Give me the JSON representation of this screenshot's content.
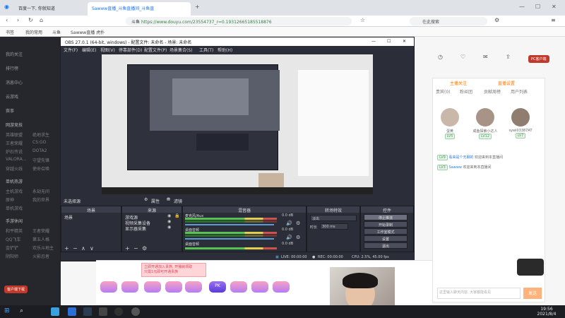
{
  "browser": {
    "tabs": [
      {
        "label": "百度一下, 你就知道",
        "active": false
      },
      {
        "label": "Sawww直播_斗鱼直播间_斗鱼直",
        "active": true
      }
    ],
    "url": "https://www.douyu.com/23554737_r=0.19312665185518876",
    "url_prefix": "斗鱼",
    "search_placeholder": "在此搜索",
    "bookmarks": [
      "书签",
      "我的常用",
      "斗鱼",
      "Sawww直播 虎扑"
    ]
  },
  "sidebar": {
    "items": [
      "我的关注",
      "排行榜",
      "消息中心",
      "云游戏",
      "赛事"
    ],
    "sections": [
      {
        "title": "网游竞技",
        "subs": [
          "英雄联盟",
          "绝地求生",
          "王者荣耀",
          "CS:GO",
          "炉石传说",
          "DOTA2",
          "VALORA...",
          "守望先锋",
          "穿越火线",
          "使命召唤"
        ]
      },
      {
        "title": "单机热游",
        "subs": [
          "主机游戏",
          "永劫无间",
          "原神",
          "我的世界",
          "单机游戏"
        ]
      },
      {
        "title": "手游休闲",
        "subs": [
          "和平精英",
          "王者荣耀",
          "QQ飞车",
          "第五人格",
          "金铲铲",
          "欢乐斗地主",
          "阴阳师",
          "火影忍者"
        ]
      }
    ],
    "buttons": [
      "客户端下载",
      "开播"
    ]
  },
  "obs": {
    "title": "OBS 27.0.1 (64-bit, windows) - 配置文件: 未命名 - 场景: 未命名",
    "menu": [
      "文件(F)",
      "编辑(E)",
      "视图(V)",
      "停靠部件(D)",
      "配置文件(P)",
      "场景集合(S)",
      "工具(T)",
      "帮助(H)"
    ],
    "window_controls": [
      "—",
      "☐",
      "✕"
    ],
    "source_selection": "未选择源",
    "toolbar": [
      "属性",
      "滤镜"
    ],
    "scenes": {
      "title": "场景",
      "items": [
        "场景"
      ]
    },
    "sources": {
      "title": "来源",
      "items": [
        "游戏源",
        "视频采集设备",
        "显示器采集"
      ]
    },
    "mixer": {
      "title": "混音器",
      "channels": [
        {
          "name": "麦克风/Aux",
          "db": "0.0 dB"
        },
        {
          "name": "桌面音频",
          "db": "0.0 dB"
        },
        {
          "name": "桌面音频",
          "db": "0.0 dB"
        }
      ]
    },
    "transitions": {
      "title": "转场特效",
      "type": "淡出",
      "duration_label": "时长",
      "duration": "300 ms"
    },
    "controls": {
      "title": "控件",
      "buttons": [
        "停止推流",
        "开始录制",
        "工作室模式",
        "设置",
        "退出"
      ]
    },
    "status": {
      "live": "LIVE: 00:00:00",
      "rec": "REC: 00:00:00",
      "cpu": "CPU: 2.5%, 45.00 fps"
    }
  },
  "douyu": {
    "right_tabs": [
      "贵宾(0)",
      "粉丝团",
      "贡献周榜",
      "用户列表"
    ],
    "pc_button": "PC客户端",
    "follow_label": "主播关注",
    "douyu_label": "直播设置",
    "users": [
      {
        "name": "蛋黄",
        "level": "LV5"
      },
      {
        "name": "咸鱼探索小达人",
        "level": "LV12"
      },
      {
        "name": "sywi03387AT",
        "level": "LV7"
      }
    ],
    "chat": [
      {
        "badge": "LV9",
        "user": "看来是个无聊的",
        "text": "欢迎来到本直播间"
      },
      {
        "badge": "LV3",
        "user": "Sawww",
        "text": "欢迎来到本直播间"
      }
    ],
    "promo": [
      "立即开通加入贵族, 开播就领取",
      "只需1元即可开通贵族"
    ],
    "gifts": [
      "荧光棒",
      "办卡",
      "飞机",
      "火箭",
      "超级火箭",
      "PK",
      "告白",
      "能量",
      "星空"
    ],
    "chat_input": "这里输入聊天内容, 大家都能看见",
    "send": "发送",
    "share_label": "分享",
    "cursor_hint": ""
  },
  "taskbar": {
    "time": "19:56",
    "date": "2021/8/4"
  },
  "colors": {
    "obs_bg": "#2b2e38",
    "douyu_orange": "#ff7700",
    "link_green": "#3a7d44",
    "meter_green": "#56c451"
  }
}
